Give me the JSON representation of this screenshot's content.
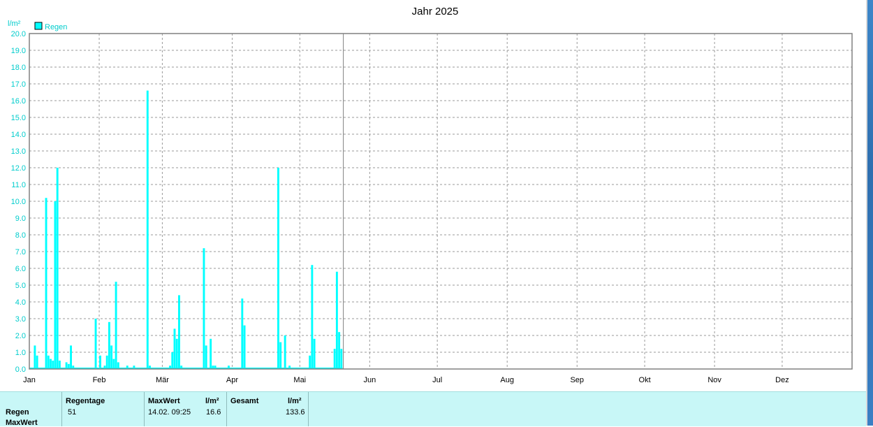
{
  "chart_data": {
    "type": "bar",
    "title": "Jahr 2025",
    "ylabel": "l/m²",
    "ylim": [
      0,
      20
    ],
    "yticks": [
      "0.0",
      "1.0",
      "2.0",
      "3.0",
      "4.0",
      "5.0",
      "6.0",
      "7.0",
      "8.0",
      "9.0",
      "10.0",
      "11.0",
      "12.0",
      "13.0",
      "14.0",
      "15.0",
      "16.0",
      "17.0",
      "18.0",
      "19.0",
      "20.0"
    ],
    "months": [
      "Jan",
      "Feb",
      "Mär",
      "Apr",
      "Mai",
      "Jun",
      "Jul",
      "Aug",
      "Sep",
      "Okt",
      "Nov",
      "Dez"
    ],
    "grid": true,
    "legend": "top-left",
    "color": "#00ffff",
    "current_day": 138,
    "series": [
      {
        "name": "Regen",
        "points": [
          [
            2,
            1.4
          ],
          [
            3,
            0.8
          ],
          [
            7,
            10.2
          ],
          [
            8,
            0.8
          ],
          [
            9,
            0.6
          ],
          [
            10,
            0.5
          ],
          [
            11,
            10.0
          ],
          [
            12,
            12.0
          ],
          [
            13,
            0.5
          ],
          [
            16,
            0.4
          ],
          [
            17,
            0.3
          ],
          [
            18,
            1.4
          ],
          [
            19,
            0.2
          ],
          [
            29,
            3.0
          ],
          [
            31,
            0.8
          ],
          [
            33,
            0.2
          ],
          [
            34,
            0.8
          ],
          [
            35,
            2.8
          ],
          [
            36,
            1.4
          ],
          [
            37,
            0.6
          ],
          [
            38,
            5.2
          ],
          [
            39,
            0.4
          ],
          [
            43,
            0.2
          ],
          [
            46,
            0.2
          ],
          [
            52,
            16.6
          ],
          [
            53,
            0.2
          ],
          [
            62,
            0.2
          ],
          [
            63,
            1.0
          ],
          [
            64,
            2.4
          ],
          [
            65,
            1.8
          ],
          [
            66,
            4.4
          ],
          [
            67,
            0.2
          ],
          [
            77,
            7.2
          ],
          [
            78,
            1.4
          ],
          [
            80,
            1.8
          ],
          [
            81,
            0.2
          ],
          [
            82,
            0.2
          ],
          [
            88,
            0.2
          ],
          [
            94,
            4.2
          ],
          [
            95,
            2.6
          ],
          [
            110,
            12.0
          ],
          [
            111,
            1.6
          ],
          [
            113,
            2.0
          ],
          [
            115,
            0.2
          ],
          [
            124,
            0.8
          ],
          [
            125,
            6.2
          ],
          [
            126,
            1.8
          ],
          [
            135,
            1.2
          ],
          [
            136,
            5.8
          ],
          [
            137,
            2.2
          ],
          [
            138,
            1.2
          ]
        ]
      }
    ]
  },
  "stats": {
    "row_labels": [
      "Regen",
      "MaxWert"
    ],
    "regentage_header": "Regentage",
    "regentage_value": "51",
    "maxwert_header": "MaxWert",
    "maxwert_unit": "l/m²",
    "maxwert_date": "14.02.  09:25",
    "maxwert_value": "16.6",
    "gesamt_header": "Gesamt",
    "gesamt_unit": "l/m²",
    "gesamt_value": "133.6"
  }
}
